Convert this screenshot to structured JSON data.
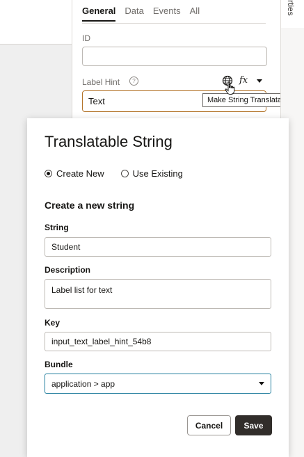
{
  "side_panel": {
    "vertical_tab": "rties"
  },
  "properties": {
    "tabs": [
      {
        "label": "General"
      },
      {
        "label": "Data"
      },
      {
        "label": "Events"
      },
      {
        "label": "All"
      }
    ],
    "id_label": "ID",
    "id_value": "",
    "label_hint_label": "Label Hint",
    "help_glyph": "?",
    "label_hint_value": "Text",
    "fx_label": "fx",
    "tooltip": "Make String Translatable"
  },
  "dialog": {
    "title": "Translatable String",
    "radio_create": "Create New",
    "radio_existing": "Use Existing",
    "selected_option": "Create New",
    "section_title": "Create a new string",
    "string_label": "String",
    "string_value": "Student",
    "description_label": "Description",
    "description_value": "Label list for text",
    "key_label": "Key",
    "key_value": "input_text_label_hint_54b8",
    "bundle_label": "Bundle",
    "bundle_value": "application > app",
    "cancel_label": "Cancel",
    "save_label": "Save"
  },
  "colors": {
    "accent_focus": "#b3742a",
    "select_border": "#227e9e",
    "primary_button": "#312d2a"
  },
  "icons": [
    "help-icon",
    "globe-icon",
    "fx-icon",
    "chevron-down-icon",
    "hand-cursor-icon"
  ]
}
